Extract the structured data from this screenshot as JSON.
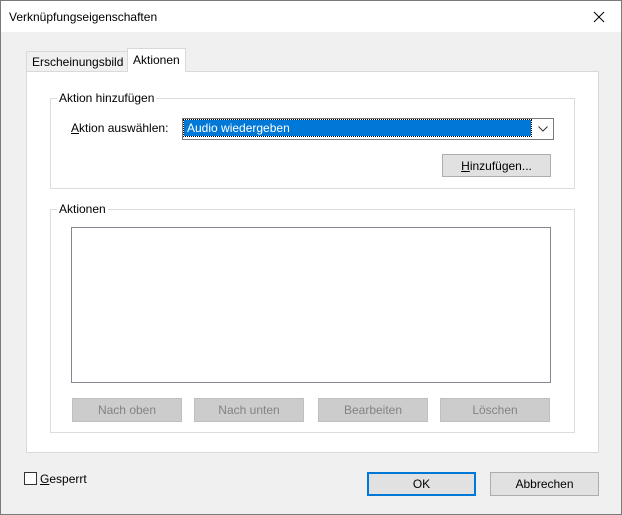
{
  "window": {
    "title": "Verknüpfungseigenschaften"
  },
  "tabs": [
    {
      "label": "Erscheinungsbild"
    },
    {
      "label": "Aktionen"
    }
  ],
  "add_action_group": {
    "legend": "Aktion hinzufügen",
    "select_label_prefix": "A",
    "select_label_rest": "ktion auswählen:",
    "selected_value": "Audio wiedergeben",
    "add_button_prefix": "H",
    "add_button_rest": "inzufügen..."
  },
  "actions_group": {
    "legend": "Aktionen",
    "buttons": {
      "up": "Nach oben",
      "down": "Nach unten",
      "edit": "Bearbeiten",
      "delete": "Löschen"
    }
  },
  "footer": {
    "locked_prefix": "G",
    "locked_rest": "esperrt",
    "ok": "OK",
    "cancel": "Abbrechen"
  }
}
